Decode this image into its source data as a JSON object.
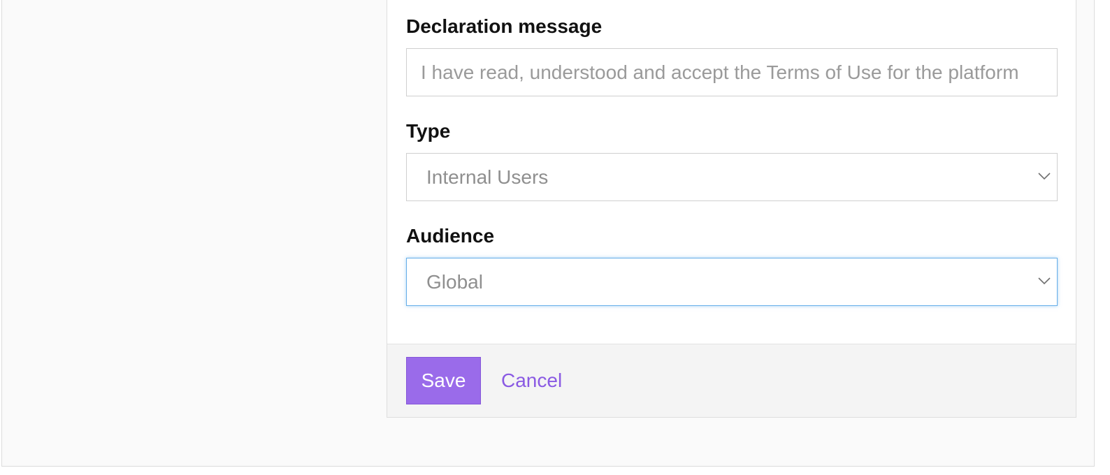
{
  "form": {
    "declaration": {
      "label": "Declaration message",
      "value": "",
      "placeholder": "I have read, understood and accept the Terms of Use for the platform"
    },
    "type": {
      "label": "Type",
      "selected": "Internal Users"
    },
    "audience": {
      "label": "Audience",
      "selected": "Global",
      "state": "focused"
    }
  },
  "footer": {
    "save_label": "Save",
    "cancel_label": "Cancel"
  },
  "colors": {
    "primary": "#9a6bea",
    "link": "#8a5ae3",
    "focus": "#66aee9"
  },
  "icons": {
    "select_arrow": "chevron-down-icon"
  }
}
